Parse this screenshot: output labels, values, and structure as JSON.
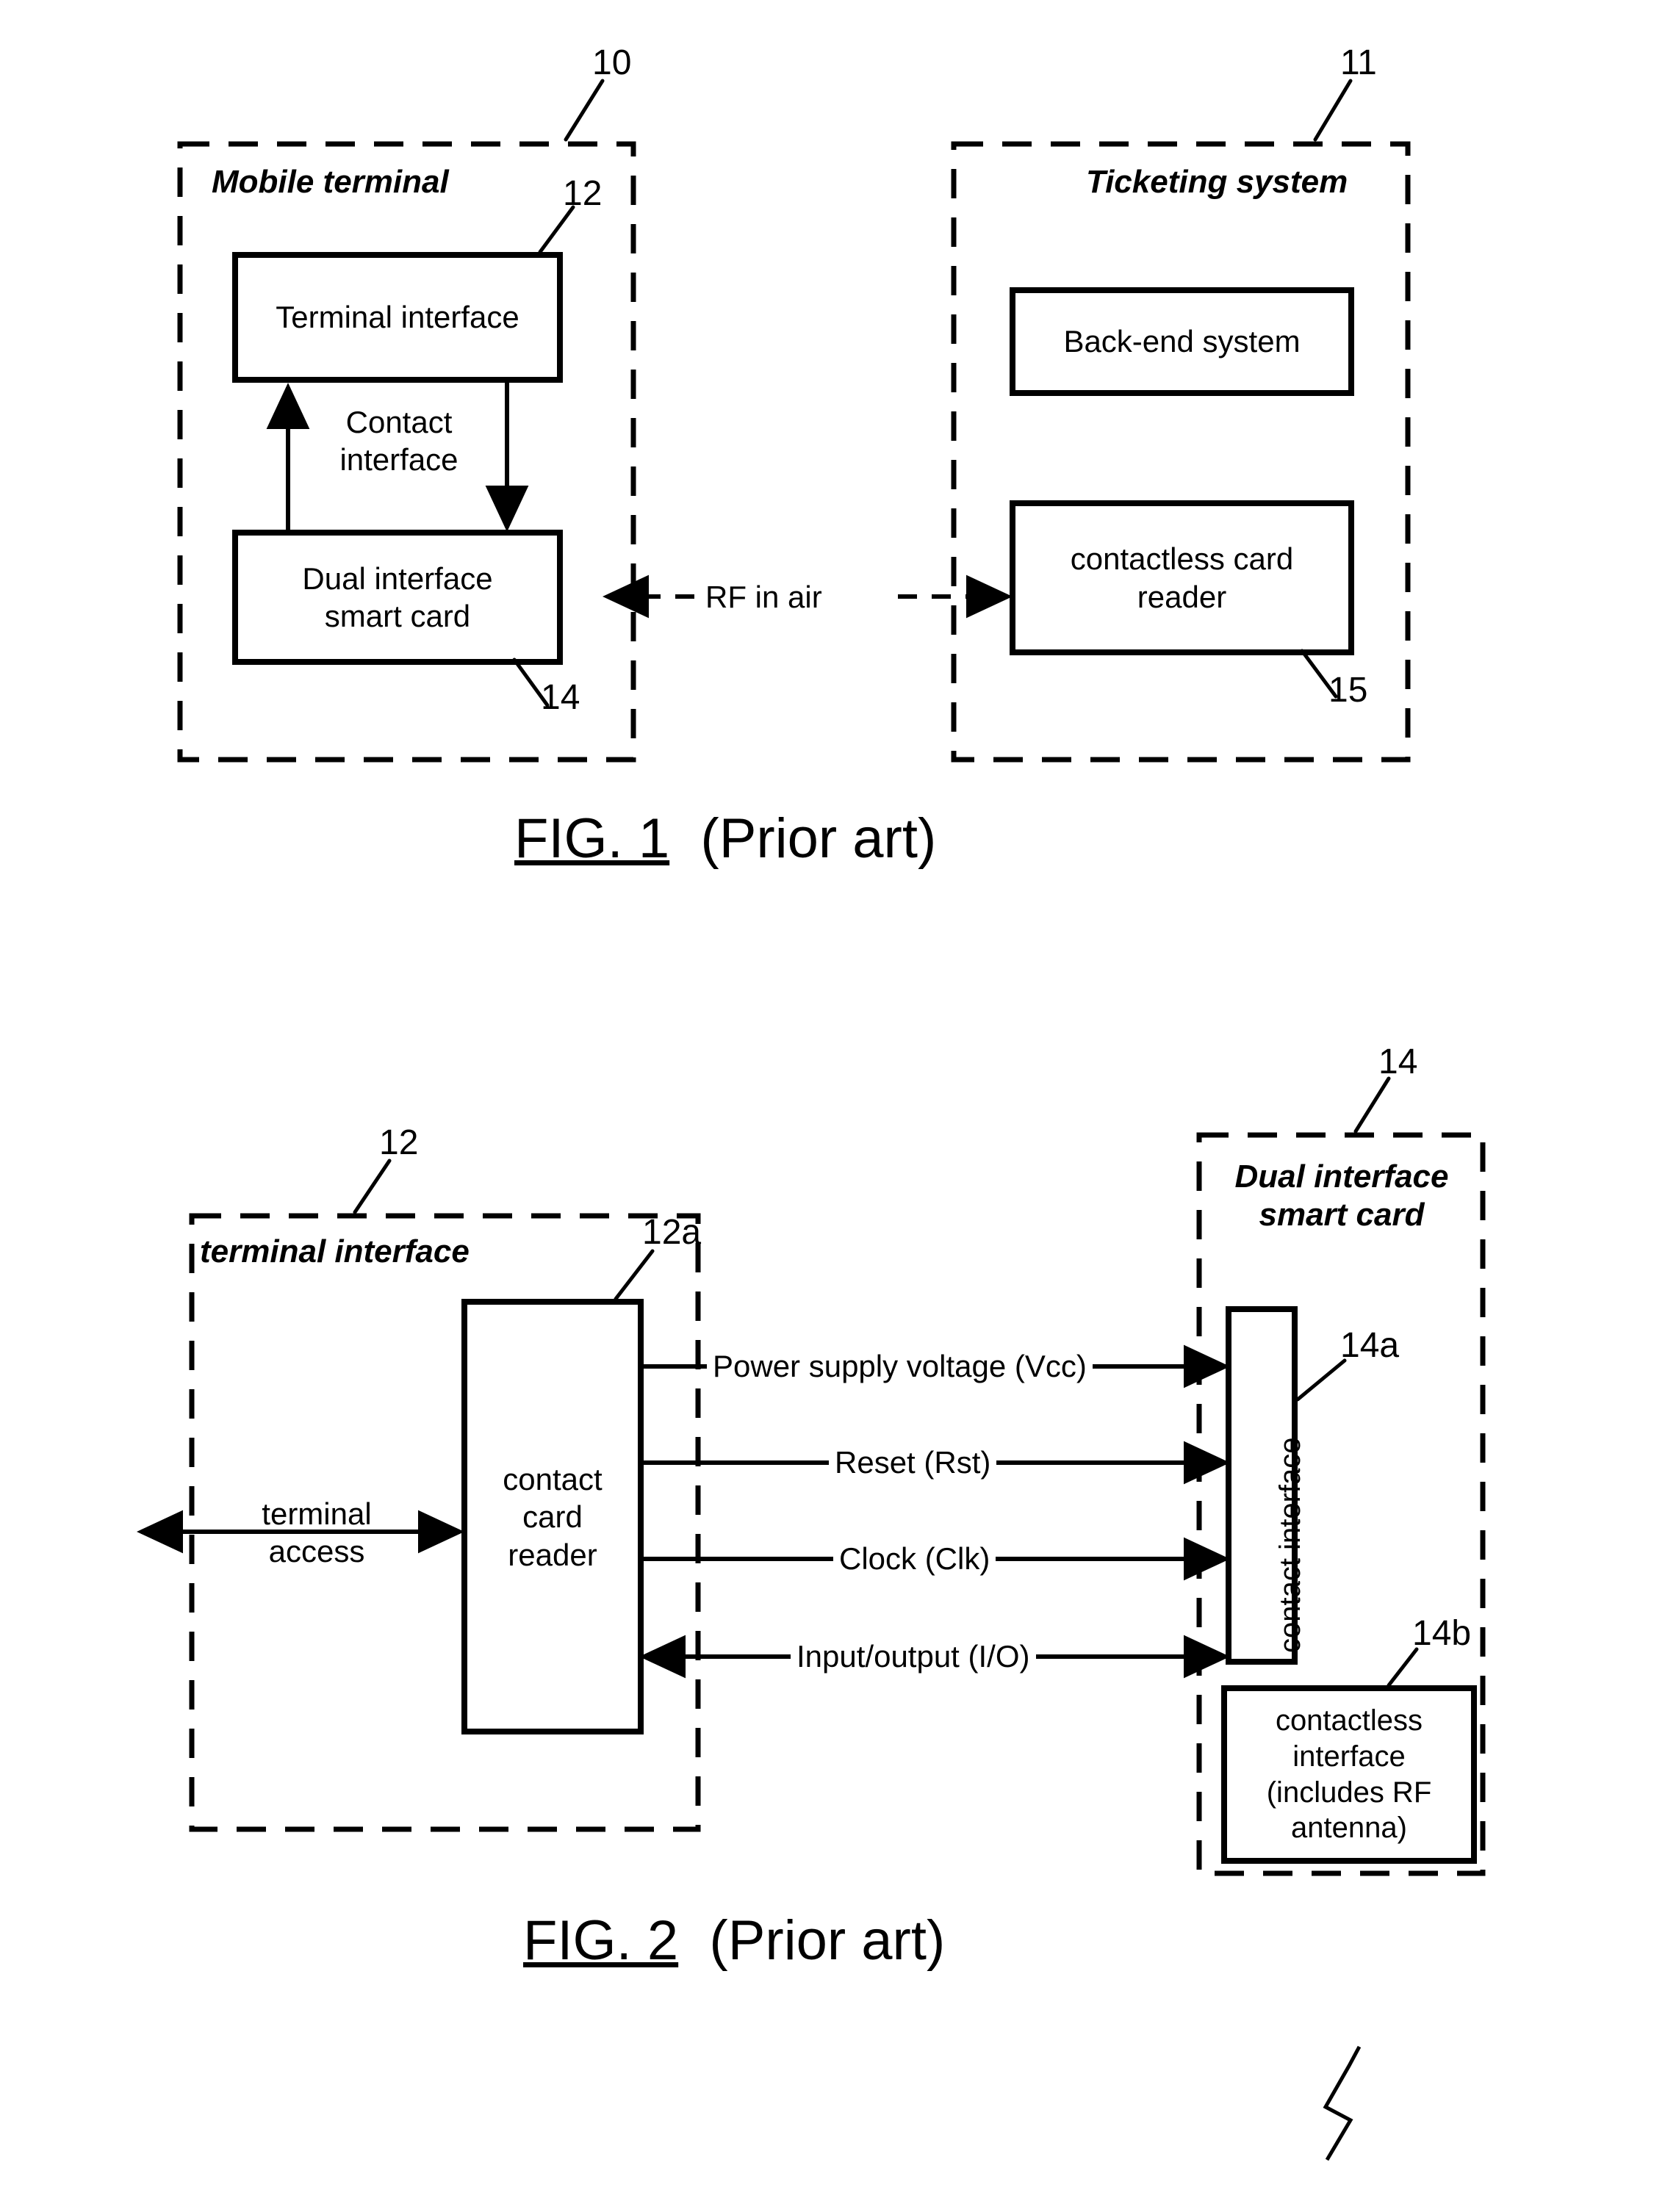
{
  "document": {
    "type": "patent-drawing-sheet",
    "figure_count": 2
  },
  "figure1": {
    "caption_main": "FIG. 1",
    "caption_suffix": "(Prior art)",
    "groups": [
      {
        "title": "Mobile terminal",
        "ref": "10"
      },
      {
        "title": "Ticketing system",
        "ref": "11"
      }
    ],
    "blocks": [
      {
        "label": "Terminal interface",
        "ref": "12"
      },
      {
        "label": "Dual interface\nsmart card",
        "ref": "14"
      },
      {
        "label": "Back-end system",
        "ref": ""
      },
      {
        "label": "contactless card\nreader",
        "ref": "15"
      }
    ],
    "connector_labels": [
      {
        "text": "Contact\ninterface"
      },
      {
        "text": "RF in air"
      }
    ]
  },
  "figure2": {
    "caption_main": "FIG. 2",
    "caption_suffix": "(Prior art)",
    "groups": [
      {
        "title": "terminal interface",
        "ref": "12"
      },
      {
        "title": "Dual interface\nsmart card",
        "ref": "14"
      }
    ],
    "blocks": [
      {
        "label": "contact\ncard\nreader",
        "ref": "12a"
      },
      {
        "label": "contact interface",
        "ref": "14a"
      },
      {
        "label": "contactless\ninterface\n(includes RF\nantenna)",
        "ref": "14b"
      }
    ],
    "signals": [
      {
        "text": "Power supply voltage (Vcc)",
        "direction": "right"
      },
      {
        "text": "Reset (Rst)",
        "direction": "right"
      },
      {
        "text": "Clock (Clk)",
        "direction": "right"
      },
      {
        "text": "Input/output (I/O)",
        "direction": "both"
      }
    ],
    "connector_labels": [
      {
        "text": "terminal\naccess"
      }
    ]
  },
  "colors": {
    "ink": "#000000",
    "paper": "#ffffff"
  }
}
